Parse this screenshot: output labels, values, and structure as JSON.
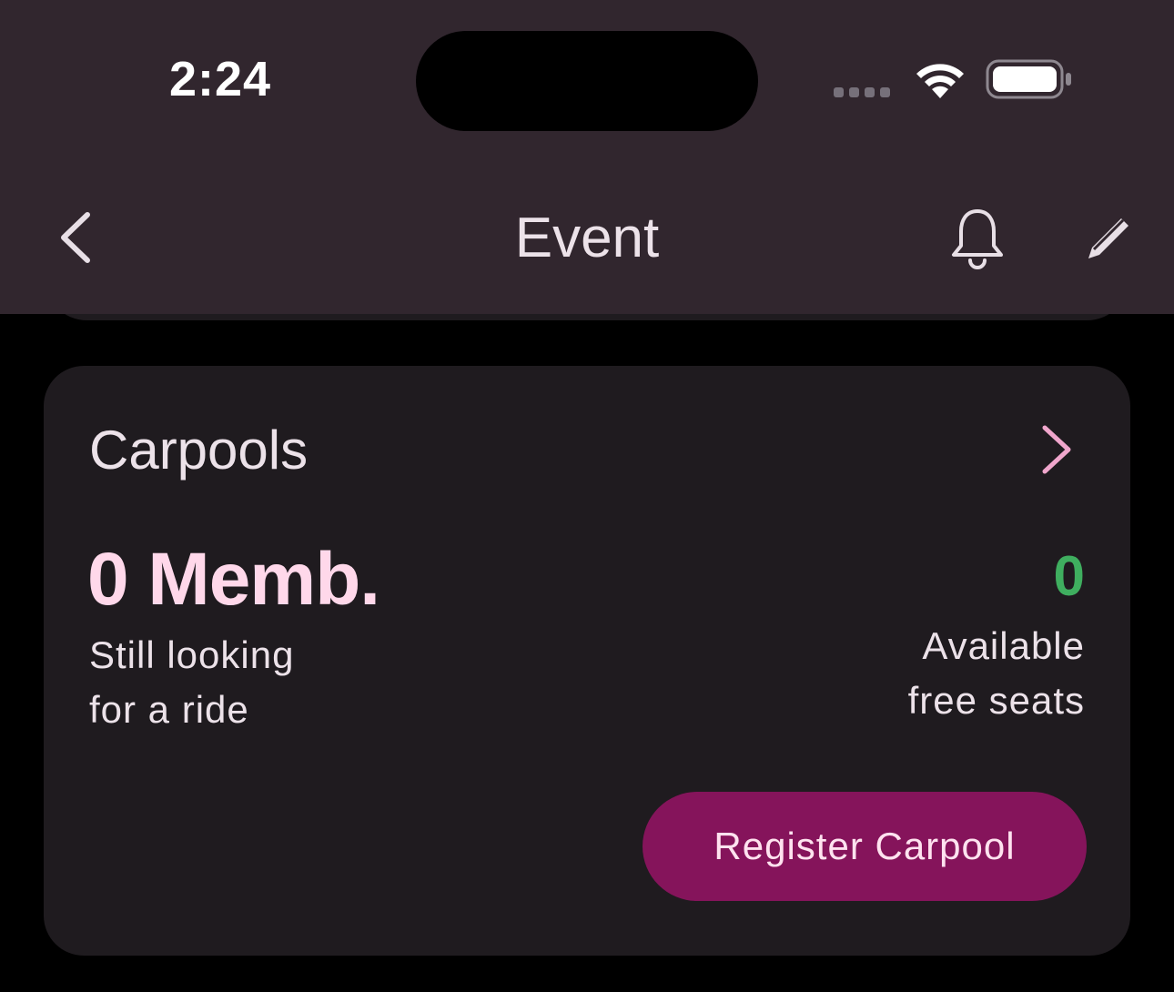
{
  "status_bar": {
    "time": "2:24"
  },
  "nav": {
    "back_icon": "chevron-left-icon",
    "title": "Event",
    "bell_icon": "bell-icon",
    "edit_icon": "pencil-icon"
  },
  "carpool_card": {
    "title": "Carpools",
    "chevron_icon": "chevron-right-icon",
    "members_count": "0 Memb.",
    "members_label_line1": "Still looking",
    "members_label_line2": "for a ride",
    "seats_count": "0",
    "seats_label_line1": "Available",
    "seats_label_line2": "free seats",
    "register_button": "Register Carpool"
  },
  "colors": {
    "header_bg": "#31262e",
    "card_bg": "#1f1b1f",
    "accent_pink": "#ffd8ea",
    "chevron_pink": "#f0a6cc",
    "seats_green": "#3fae5f",
    "button_bg": "#85145b"
  }
}
